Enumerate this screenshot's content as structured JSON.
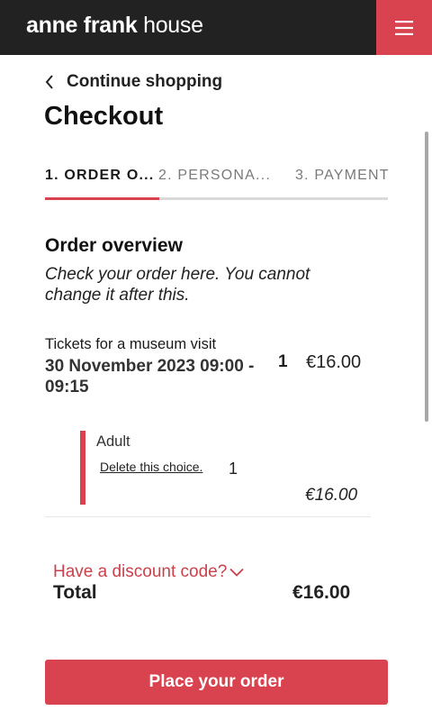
{
  "header": {
    "logo_bold": "anne frank",
    "logo_regular": "house",
    "menu_icon": "hamburger-icon",
    "colors": {
      "bar": "#222222",
      "accent": "#d9434f"
    }
  },
  "nav": {
    "back_label": "Continue shopping",
    "back_icon": "chevron-left-icon"
  },
  "page": {
    "title": "Checkout"
  },
  "steps": [
    {
      "label": "1. ORDER O...",
      "active": true
    },
    {
      "label": "2. PERSONA...",
      "active": false
    },
    {
      "label": "3. PAYMENT",
      "active": false
    }
  ],
  "overview": {
    "title": "Order overview",
    "description": "Check your order here. You cannot change it after this."
  },
  "order_item": {
    "type": "Tickets for a museum visit",
    "datetime": "30 November 2023 09:00 - 09:15",
    "quantity": "1",
    "price": "€16.00",
    "subitem": {
      "label": "Adult",
      "delete_label": "Delete this choice.",
      "quantity": "1",
      "price": "€16.00"
    }
  },
  "discount": {
    "label": "Have a discount code?",
    "icon": "chevron-down-icon"
  },
  "total": {
    "label": "Total",
    "value": "€16.00"
  },
  "actions": {
    "place_order_label": "Place your order"
  }
}
